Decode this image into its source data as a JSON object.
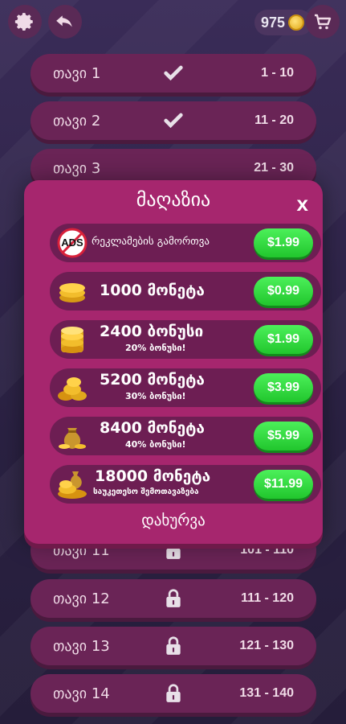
{
  "header": {
    "coins": "975",
    "settings_icon": "gear-icon",
    "back_icon": "undo-arrow-icon",
    "cart_icon": "cart-icon"
  },
  "levels": [
    {
      "name": "თავი 1",
      "range": "1 - 10",
      "status": "completed"
    },
    {
      "name": "თავი 2",
      "range": "11 - 20",
      "status": "completed"
    },
    {
      "name": "თავი 3",
      "range": "21 - 30",
      "status": "open"
    },
    {
      "name": "თავი 11",
      "range": "101 - 110",
      "status": "locked"
    },
    {
      "name": "თავი 12",
      "range": "111 - 120",
      "status": "locked"
    },
    {
      "name": "თავი 13",
      "range": "121 - 130",
      "status": "locked"
    },
    {
      "name": "თავი 14",
      "range": "131 - 140",
      "status": "locked"
    }
  ],
  "shop": {
    "title": "მაღაზია",
    "close_x": "x",
    "close_label": "დახურვა",
    "remove_ads": {
      "badge": "ADS",
      "label": "რეკლამების გამორთვა",
      "price": "$1.99"
    },
    "offers": [
      {
        "amount": "1000 მონეტა",
        "bonus": "",
        "price": "$0.99"
      },
      {
        "amount": "2400 ბონუსი",
        "bonus": "20% ბონუსი!",
        "price": "$1.99"
      },
      {
        "amount": "5200 მონეტა",
        "bonus": "30% ბონუსი!",
        "price": "$3.99"
      },
      {
        "amount": "8400 მონეტა",
        "bonus": "40% ბონუსი!",
        "price": "$5.99"
      },
      {
        "amount": "18000 მონეტა",
        "bonus": "საუკეთესო შემოთავაზება",
        "price": "$11.99"
      }
    ]
  },
  "colors": {
    "modal": "#a6266e",
    "offer_row": "#6d1e53",
    "price_green": "#2bd637",
    "level_row": "#6a2456"
  }
}
